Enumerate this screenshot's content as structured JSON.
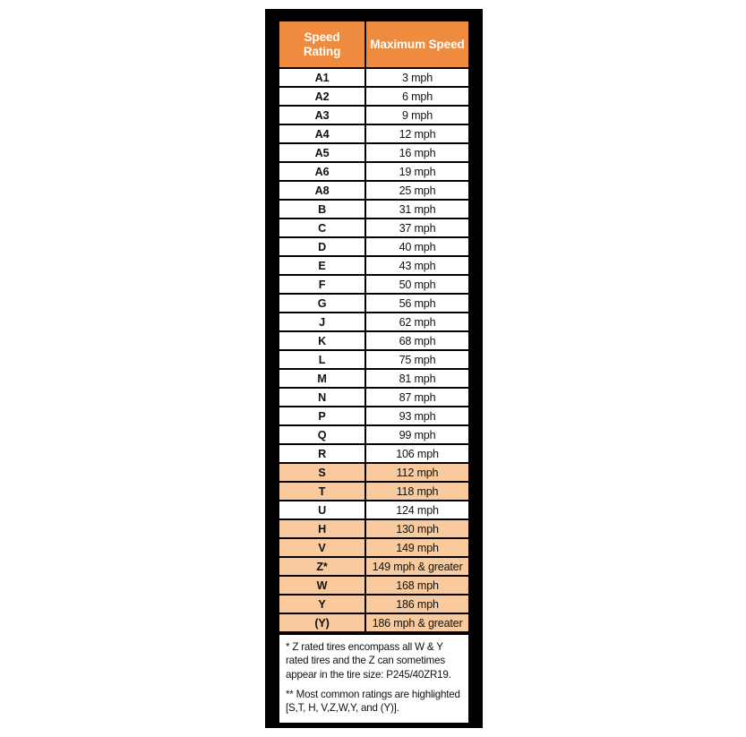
{
  "table": {
    "columns": [
      "Speed Rating",
      "Maximum Speed"
    ],
    "header": {
      "rating_line1": "Speed",
      "rating_line2": "Rating",
      "speed": "Maximum Speed"
    },
    "rows": [
      {
        "rating": "A1",
        "speed": "3 mph",
        "highlighted": false
      },
      {
        "rating": "A2",
        "speed": "6 mph",
        "highlighted": false
      },
      {
        "rating": "A3",
        "speed": "9 mph",
        "highlighted": false
      },
      {
        "rating": "A4",
        "speed": "12 mph",
        "highlighted": false
      },
      {
        "rating": "A5",
        "speed": "16 mph",
        "highlighted": false
      },
      {
        "rating": "A6",
        "speed": "19 mph",
        "highlighted": false
      },
      {
        "rating": "A8",
        "speed": "25 mph",
        "highlighted": false
      },
      {
        "rating": "B",
        "speed": "31 mph",
        "highlighted": false
      },
      {
        "rating": "C",
        "speed": "37 mph",
        "highlighted": false
      },
      {
        "rating": "D",
        "speed": "40 mph",
        "highlighted": false
      },
      {
        "rating": "E",
        "speed": "43 mph",
        "highlighted": false
      },
      {
        "rating": "F",
        "speed": "50 mph",
        "highlighted": false
      },
      {
        "rating": "G",
        "speed": "56 mph",
        "highlighted": false
      },
      {
        "rating": "J",
        "speed": "62 mph",
        "highlighted": false
      },
      {
        "rating": "K",
        "speed": "68 mph",
        "highlighted": false
      },
      {
        "rating": "L",
        "speed": "75 mph",
        "highlighted": false
      },
      {
        "rating": "M",
        "speed": "81 mph",
        "highlighted": false
      },
      {
        "rating": "N",
        "speed": "87 mph",
        "highlighted": false
      },
      {
        "rating": "P",
        "speed": "93 mph",
        "highlighted": false
      },
      {
        "rating": "Q",
        "speed": "99 mph",
        "highlighted": false
      },
      {
        "rating": "R",
        "speed": "106 mph",
        "highlighted": false
      },
      {
        "rating": "S",
        "speed": "112 mph",
        "highlighted": true
      },
      {
        "rating": "T",
        "speed": "118 mph",
        "highlighted": true
      },
      {
        "rating": "U",
        "speed": "124 mph",
        "highlighted": false
      },
      {
        "rating": "H",
        "speed": "130 mph",
        "highlighted": true
      },
      {
        "rating": "V",
        "speed": "149 mph",
        "highlighted": true
      },
      {
        "rating": "Z*",
        "speed": "149 mph & greater",
        "highlighted": true
      },
      {
        "rating": "W",
        "speed": "168 mph",
        "highlighted": true
      },
      {
        "rating": "Y",
        "speed": "186 mph",
        "highlighted": true
      },
      {
        "rating": "(Y)",
        "speed": "186 mph & greater",
        "highlighted": true
      }
    ]
  },
  "notes": {
    "note1": "* Z rated tires encompass all W & Y rated tires and the Z can sometimes appear in the tire size: P245/40ZR19.",
    "note2": "** Most common ratings are highlighted [S,T, H, V,Z,W,Y, and (Y)]."
  },
  "colors": {
    "header_orange": "#ef8b3f",
    "highlight_peach": "#f8ca9d",
    "frame_black": "#000000",
    "cell_white": "#ffffff",
    "text_dark": "#111111"
  }
}
